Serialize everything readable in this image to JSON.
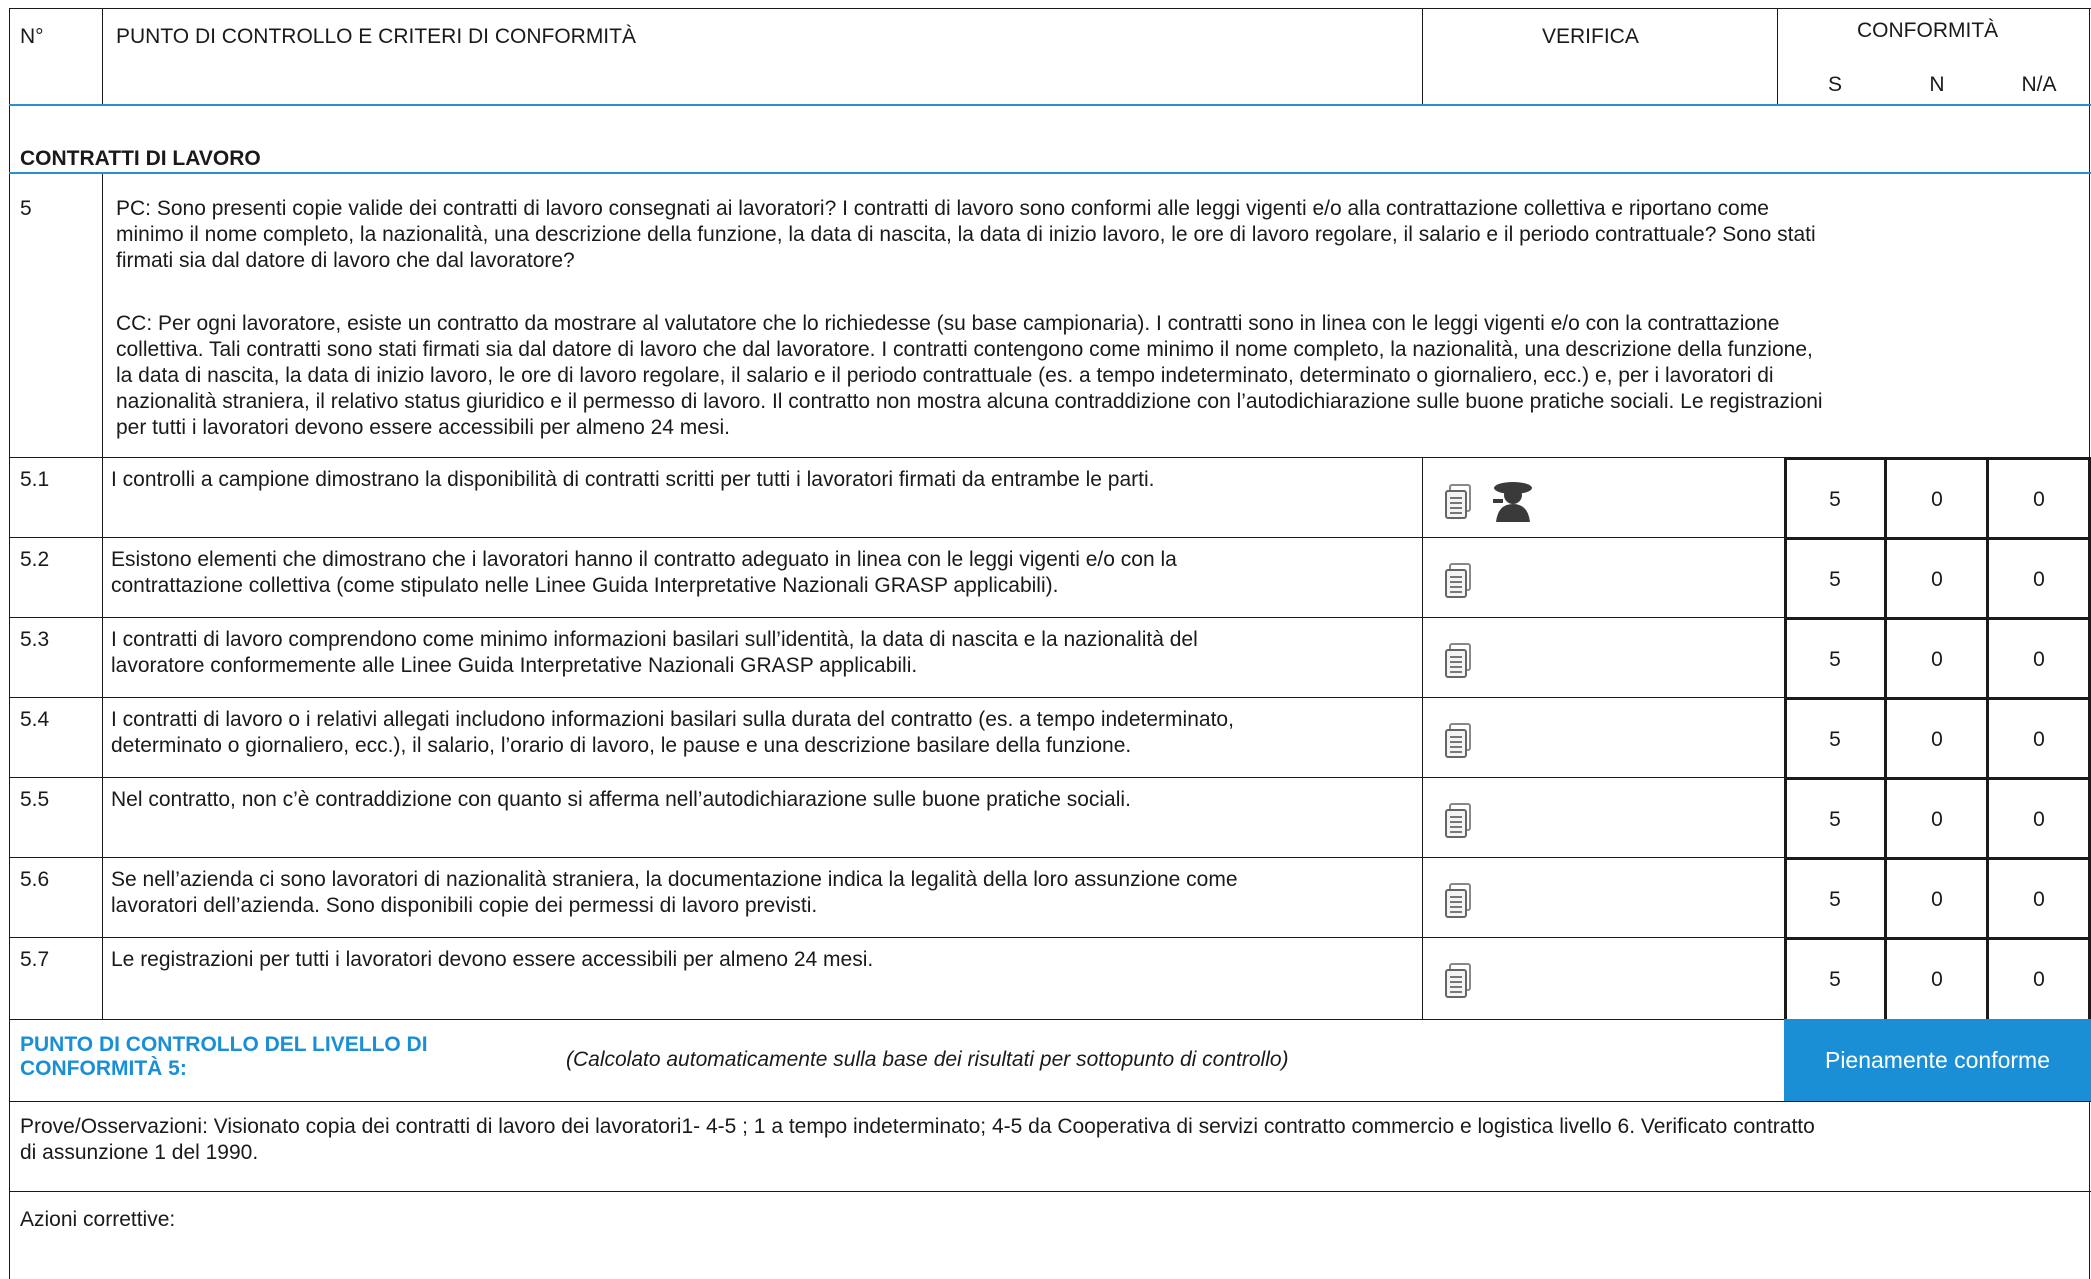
{
  "header": {
    "col_n": "N°",
    "col_criteria": "PUNTO DI CONTROLLO E CRITERI DI CONFORMITÀ",
    "col_verifica": "VERIFICA",
    "col_conformita": "CONFORMITÀ",
    "col_s": "S",
    "col_n2": "N",
    "col_na": "N/A"
  },
  "section_title": "CONTRATTI DI LAVORO",
  "control_point": {
    "number": "5",
    "pc_lines": [
      "PC: Sono presenti copie valide dei contratti di lavoro consegnati ai lavoratori? I contratti di lavoro sono conformi alle leggi vigenti e/o alla contrattazione collettiva e riportano come",
      "minimo il nome completo, la nazionalità, una descrizione della funzione, la data di nascita, la data di inizio lavoro, le ore di lavoro regolare, il salario e il periodo contrattuale? Sono stati",
      "firmati sia dal datore di lavoro che dal lavoratore?"
    ],
    "cc_lines": [
      "CC: Per ogni lavoratore, esiste un contratto da mostrare al valutatore che lo richiedesse (su base campionaria). I contratti sono in linea con le leggi vigenti e/o con la contrattazione",
      "collettiva. Tali contratti sono stati firmati sia dal datore di lavoro che dal lavoratore. I contratti contengono come minimo il nome completo, la nazionalità, una descrizione della funzione,",
      "la data di nascita, la data di inizio lavoro, le ore di lavoro regolare, il salario e il periodo contrattuale (es. a tempo indeterminato, determinato o giornaliero, ecc.) e, per i lavoratori di",
      "nazionalità straniera, il relativo status giuridico e il permesso di lavoro. Il contratto non mostra alcuna contraddizione con l’autodichiarazione sulle buone pratiche sociali. Le registrazioni",
      "per tutti i lavoratori devono essere accessibili per almeno 24 mesi."
    ]
  },
  "rows": [
    {
      "id": "5.1",
      "lines": [
        "I controlli a campione dimostrano la disponibilità di contratti scritti per tutti i lavoratori firmati da entrambe le parti."
      ],
      "icons": [
        "document-icon",
        "interview-person-icon"
      ],
      "s": "5",
      "n": "0",
      "na": "0"
    },
    {
      "id": "5.2",
      "lines": [
        "Esistono elementi che dimostrano che i lavoratori hanno il contratto adeguato in linea con le leggi vigenti e/o con la",
        "contrattazione collettiva (come stipulato nelle Linee Guida Interpretative Nazionali GRASP applicabili)."
      ],
      "icons": [
        "document-icon"
      ],
      "s": "5",
      "n": "0",
      "na": "0"
    },
    {
      "id": "5.3",
      "lines": [
        "I contratti di lavoro comprendono come minimo informazioni basilari sull’identità, la data di nascita e la nazionalità del",
        "lavoratore conformemente alle Linee Guida Interpretative Nazionali GRASP applicabili."
      ],
      "icons": [
        "document-icon"
      ],
      "s": "5",
      "n": "0",
      "na": "0"
    },
    {
      "id": "5.4",
      "lines": [
        "I contratti di lavoro o i relativi allegati includono informazioni basilari sulla durata del contratto (es. a tempo indeterminato,",
        "determinato o giornaliero, ecc.), il salario, l’orario di lavoro, le pause e una descrizione basilare della funzione."
      ],
      "icons": [
        "document-icon"
      ],
      "s": "5",
      "n": "0",
      "na": "0"
    },
    {
      "id": "5.5",
      "lines": [
        "Nel contratto, non c’è contraddizione con quanto si afferma nell’autodichiarazione sulle buone pratiche sociali."
      ],
      "icons": [
        "document-icon"
      ],
      "s": "5",
      "n": "0",
      "na": "0"
    },
    {
      "id": "5.6",
      "lines": [
        "Se nell’azienda ci sono lavoratori di nazionalità straniera, la documentazione indica la legalità della loro assunzione come",
        "lavoratori dell’azienda. Sono disponibili copie dei permessi di lavoro previsti."
      ],
      "icons": [
        "document-icon"
      ],
      "s": "5",
      "n": "0",
      "na": "0"
    },
    {
      "id": "5.7",
      "lines": [
        "Le registrazioni per tutti i lavoratori devono essere accessibili per almeno 24 mesi."
      ],
      "icons": [
        "document-icon"
      ],
      "s": "5",
      "n": "0",
      "na": "0"
    }
  ],
  "summary": {
    "label_line1": "PUNTO DI CONTROLLO DEL LIVELLO DI",
    "label_line2": "CONFORMITÀ 5:",
    "note": "(Calcolato automaticamente sulla base dei risultati per sottopunto di controllo)",
    "status": "Pienamente conforme"
  },
  "observations": {
    "line1": "Prove/Osservazioni: Visionato copia dei contratti di lavoro dei lavoratori1- 4-5 ; 1 a tempo indeterminato; 4-5 da Cooperativa di servizi contratto commercio e logistica livello 6. Verificato contratto",
    "line2": "di assunzione 1 del 1990."
  },
  "corrective_actions": {
    "label": "Azioni correttive:"
  },
  "colors": {
    "accent": "#1a8fd6",
    "border": "#1a1a1a"
  }
}
